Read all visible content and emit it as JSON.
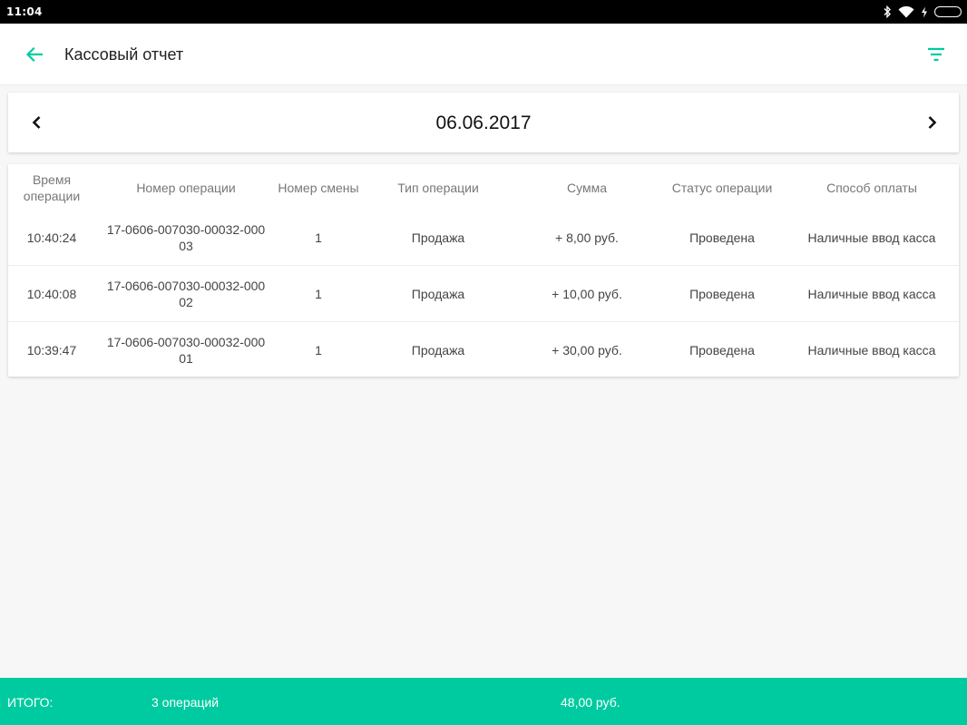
{
  "status_bar": {
    "time": "11:04",
    "icons": [
      "bluetooth-icon",
      "wifi-icon",
      "charging-icon",
      "battery-icon"
    ]
  },
  "app_bar": {
    "title": "Кассовый отчет",
    "back_icon": "arrow-left-icon",
    "filter_icon": "filter-icon"
  },
  "date_nav": {
    "date": "06.06.2017",
    "prev_icon": "chevron-left-icon",
    "next_icon": "chevron-right-icon"
  },
  "table": {
    "headers": [
      "Время операции",
      "Номер операции",
      "Номер смены",
      "Тип операции",
      "Сумма",
      "Статус операции",
      "Способ оплаты"
    ],
    "rows": [
      {
        "time": "10:40:24",
        "op_number": "17-0606-007030-00032-00003",
        "shift": "1",
        "type": "Продажа",
        "sum": "+ 8,00 руб.",
        "status": "Проведена",
        "payment": "Наличные ввод касса"
      },
      {
        "time": "10:40:08",
        "op_number": "17-0606-007030-00032-00002",
        "shift": "1",
        "type": "Продажа",
        "sum": "+ 10,00 руб.",
        "status": "Проведена",
        "payment": "Наличные ввод касса"
      },
      {
        "time": "10:39:47",
        "op_number": "17-0606-007030-00032-00001",
        "shift": "1",
        "type": "Продажа",
        "sum": "+ 30,00 руб.",
        "status": "Проведена",
        "payment": "Наличные ввод касса"
      }
    ]
  },
  "footer": {
    "label": "ИТОГО:",
    "count": "3 операций",
    "total": "48,00 руб."
  },
  "colors": {
    "accent": "#00cba0",
    "background": "#f7f7f7"
  }
}
